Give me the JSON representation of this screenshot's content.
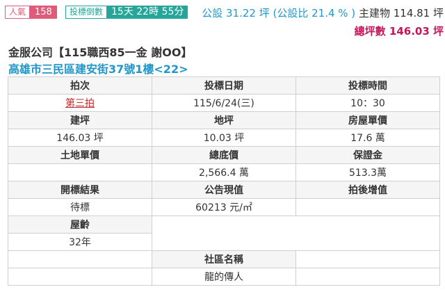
{
  "popularity": {
    "label": "人氣",
    "count": "158"
  },
  "countdown": {
    "label": "投標倒數",
    "time": "15天 22時 55分"
  },
  "area": {
    "public": "公設 31.22 坪 (公設比 21.4 % )",
    "main_label": "主建物",
    "main_value": "114.81 坪",
    "total": "總坪數 146.03 坪"
  },
  "case": {
    "owner_line": "金服公司【115職西85一金 謝OO】",
    "address": "高雄市三民區建安街37號1樓<22>"
  },
  "table": {
    "auction_round_h": "拍次",
    "auction_round": "第三拍",
    "bid_date_h": "投標日期",
    "bid_date": "115/6/24(三)",
    "bid_time_h": "投標時間",
    "bid_time": "10：30",
    "building_area_h": "建坪",
    "building_area": "146.03 坪",
    "land_area_h": "地坪",
    "land_area": "10.03 坪",
    "unit_price_h": "房屋單價",
    "unit_price": "17.6 萬",
    "land_unit_price_h": "土地單價",
    "land_unit_price": "",
    "base_price_h": "總底價",
    "base_price": "2,566.4 萬",
    "deposit_h": "保證金",
    "deposit": "513.3萬",
    "result_h": "開標結果",
    "result": "待標",
    "announced_value_h": "公告現值",
    "announced_value": "60213 元/㎡",
    "value_added_h": "拍後增值",
    "value_added": "",
    "age_h": "屋齡",
    "age": "32年",
    "community_h": "社區名稱",
    "community": "龍的傳人"
  }
}
